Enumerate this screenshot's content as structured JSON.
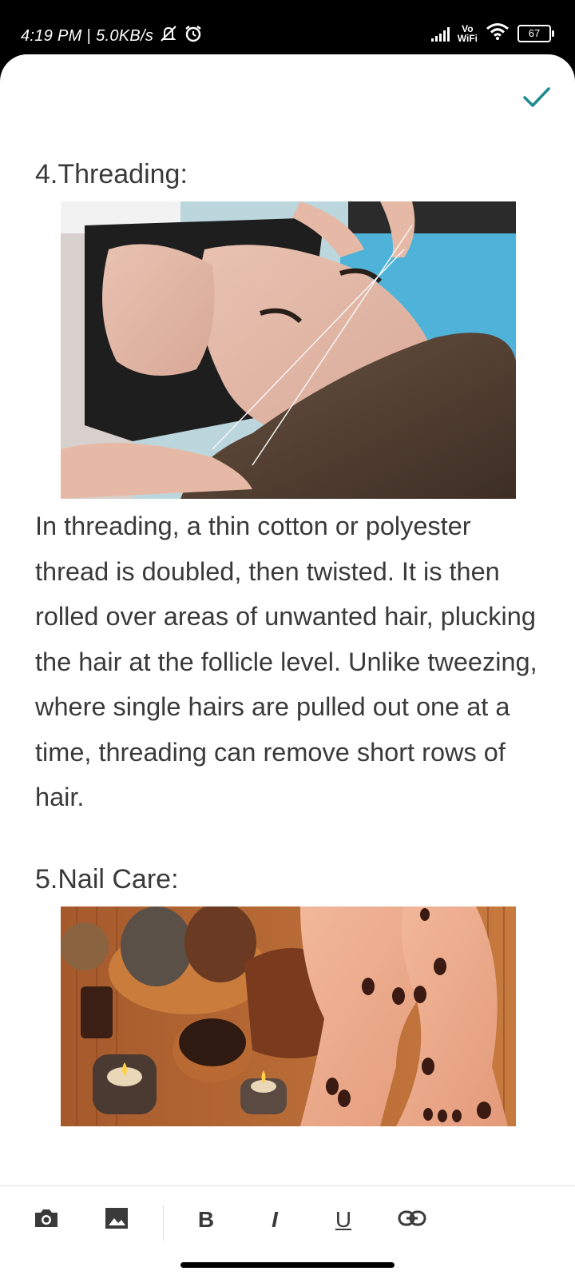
{
  "status_bar": {
    "time": "4:19 PM",
    "separator": "|",
    "net_speed": "5.0KB/s",
    "vowifi_top": "Vo",
    "vowifi_bottom": "WiFi",
    "battery": "67",
    "icons": [
      "mute-icon",
      "alarm-icon",
      "signal-icon",
      "wifi-icon",
      "battery-icon"
    ]
  },
  "editor": {
    "done_icon": "check-icon",
    "accent_color": "#1b8a8f",
    "sections": [
      {
        "heading": "4.Threading:",
        "image": "threading-photo",
        "body": "In threading, a thin cotton or polyester thread is doubled, then twisted. It is then rolled over areas of unwanted hair, plucking the hair at the follicle level. Unlike tweezing, where single hairs are pulled out one at a time, threading can remove short rows of hair."
      },
      {
        "heading": "5.Nail Care:",
        "image": "nail-care-photo"
      }
    ]
  },
  "toolbar": {
    "camera": "camera-icon",
    "gallery": "image-icon",
    "bold": "B",
    "italic": "I",
    "underline": "U",
    "link": "link-icon"
  }
}
